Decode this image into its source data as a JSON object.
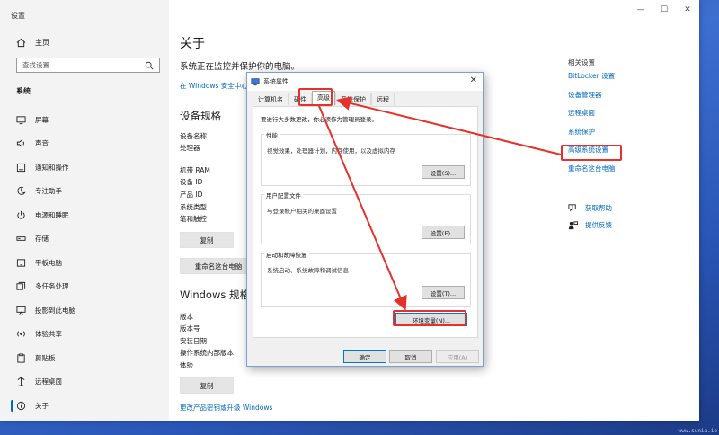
{
  "window": {
    "title": "设置",
    "controls": {
      "minimize": "—",
      "maximize": "☐",
      "close": "✕"
    }
  },
  "sidebar": {
    "home": "主页",
    "search_placeholder": "查找设置",
    "section": "系统",
    "items": [
      {
        "label": "屏幕",
        "icon": "monitor-icon"
      },
      {
        "label": "声音",
        "icon": "speaker-icon"
      },
      {
        "label": "通知和操作",
        "icon": "notification-icon"
      },
      {
        "label": "专注助手",
        "icon": "moon-icon"
      },
      {
        "label": "电源和睡眠",
        "icon": "power-icon"
      },
      {
        "label": "存储",
        "icon": "storage-icon"
      },
      {
        "label": "平板电脑",
        "icon": "tablet-icon"
      },
      {
        "label": "多任务处理",
        "icon": "multitask-icon"
      },
      {
        "label": "投影到此电脑",
        "icon": "project-icon"
      },
      {
        "label": "体验共享",
        "icon": "share-icon"
      },
      {
        "label": "剪贴板",
        "icon": "clipboard-icon"
      },
      {
        "label": "远程桌面",
        "icon": "remote-icon"
      },
      {
        "label": "关于",
        "icon": "info-icon"
      }
    ]
  },
  "main": {
    "title": "关于",
    "protect_text": "系统正在监控并保护你的电脑。",
    "security_link": "在 Windows 安全中心",
    "device_specs_title": "设备规格",
    "device_rows": [
      "设备名称",
      "处理器",
      "机带 RAM",
      "设备 ID",
      "产品 ID",
      "系统类型",
      "笔和触控"
    ],
    "copy_button": "复制",
    "rename_button": "重命名这台电脑",
    "windows_specs_title": "Windows 规格",
    "windows_rows": [
      "版本",
      "版本号",
      "安装日期",
      "操作系统内部版本",
      "体验"
    ],
    "copy_button_2": "复制",
    "upgrade_link": "更改产品密钥或升级 Windows"
  },
  "related": {
    "title": "相关设置",
    "links": [
      "BitLocker 设置",
      "设备管理器",
      "远程桌面",
      "系统保护",
      "高级系统设置",
      "重命名这台电脑"
    ],
    "help": "获取帮助",
    "feedback": "提供反馈"
  },
  "dialog": {
    "title": "系统属性",
    "close": "✕",
    "tabs": [
      "计算机名",
      "硬件",
      "高级",
      "系统保护",
      "远程"
    ],
    "active_tab": "高级",
    "note": "要进行大多数更改，你必须作为管理员登录。",
    "groups": [
      {
        "title": "性能",
        "desc": "视觉效果，处理器计划，内存使用，以及虚拟内存",
        "button": "设置(S)..."
      },
      {
        "title": "用户配置文件",
        "desc": "与登录帐户相关的桌面设置",
        "button": "设置(E)..."
      },
      {
        "title": "启动和故障恢复",
        "desc": "系统启动、系统故障和调试信息",
        "button": "设置(T)..."
      }
    ],
    "env_button": "环境变量(N)...",
    "ok": "确定",
    "cancel": "取消",
    "apply": "应用(A)"
  },
  "colors": {
    "accent": "#0067c0",
    "annotation": "#e8302b"
  },
  "watermark": "www.sunia.io"
}
